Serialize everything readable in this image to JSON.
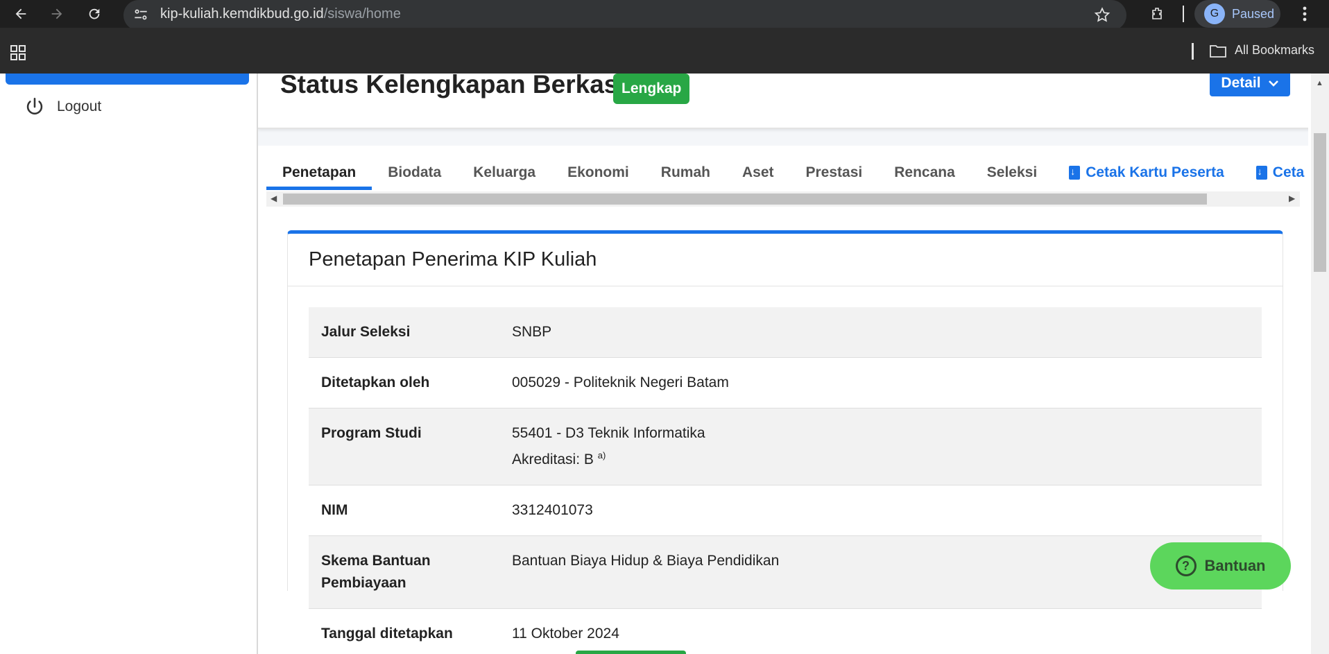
{
  "browser": {
    "url_host": "kip-kuliah.kemdikbud.go.id",
    "url_path": "/siswa/home",
    "profile_initial": "G",
    "profile_status": "Paused",
    "bookmarks_label": "All Bookmarks"
  },
  "sidebar": {
    "logout_label": "Logout"
  },
  "status": {
    "title": "Status Kelengkapan Berkas",
    "badge": "Lengkap",
    "detail_label": "Detail"
  },
  "tabs": [
    {
      "label": "Penetapan"
    },
    {
      "label": "Biodata"
    },
    {
      "label": "Keluarga"
    },
    {
      "label": "Ekonomi"
    },
    {
      "label": "Rumah"
    },
    {
      "label": "Aset"
    },
    {
      "label": "Prestasi"
    },
    {
      "label": "Rencana"
    },
    {
      "label": "Seleksi"
    },
    {
      "label": "Cetak Kartu Peserta"
    },
    {
      "label": "Ceta"
    }
  ],
  "panel": {
    "title": "Penetapan Penerima KIP Kuliah",
    "rows": [
      {
        "key": "Jalur Seleksi",
        "value": "SNBP"
      },
      {
        "key": "Ditetapkan oleh",
        "value": "005029 - Politeknik Negeri Batam"
      },
      {
        "key": "Program Studi",
        "value": "55401 - D3 Teknik Informatika",
        "value2": "Akreditasi: B",
        "sup": "a)"
      },
      {
        "key": "NIM",
        "value": "3312401073"
      },
      {
        "key": "Skema Bantuan Pembiayaan",
        "value": "Bantuan Biaya Hidup & Biaya Pendidikan"
      },
      {
        "key": "Tanggal ditetapkan",
        "value": "11 Oktober 2024"
      }
    ]
  },
  "help": {
    "label": "Bantuan"
  },
  "colors": {
    "primary": "#1a73e8",
    "success": "#28a745",
    "help": "#5cd65c"
  }
}
